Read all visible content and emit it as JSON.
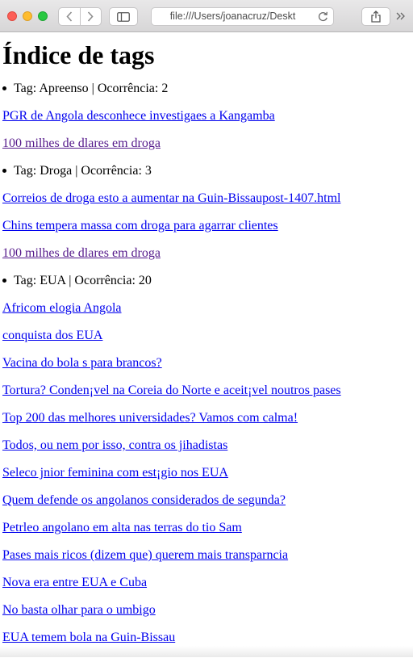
{
  "browser": {
    "url": "file:///Users/joanacruz/Deskt",
    "icons": [
      "back-icon",
      "forward-icon",
      "sidebar-icon",
      "reload-icon",
      "share-icon",
      "more-icon"
    ]
  },
  "page": {
    "title": "Índice de tags",
    "items": [
      {
        "kind": "tag",
        "text": "Tag: Apreenso | Ocorrência: 2"
      },
      {
        "kind": "link",
        "text": "PGR de Angola desconhece investigaes a Kangamba",
        "visited": false
      },
      {
        "kind": "link",
        "text": "100 milhes de dlares em droga",
        "visited": true
      },
      {
        "kind": "tag",
        "text": "Tag: Droga | Ocorrência: 3"
      },
      {
        "kind": "link",
        "text": "Correios de droga esto a aumentar na Guin-Bissaupost-1407.html",
        "visited": false
      },
      {
        "kind": "link",
        "text": "Chins tempera massa com droga para agarrar clientes",
        "visited": false
      },
      {
        "kind": "link",
        "text": "100 milhes de dlares em droga",
        "visited": true
      },
      {
        "kind": "tag",
        "text": "Tag: EUA | Ocorrência: 20"
      },
      {
        "kind": "link",
        "text": "Africom elogia Angola",
        "visited": false
      },
      {
        "kind": "link",
        "text": "conquista dos EUA",
        "visited": false
      },
      {
        "kind": "link",
        "text": "Vacina do bola s para brancos?",
        "visited": false
      },
      {
        "kind": "link",
        "text": "Tortura? Conden¡vel na Coreia do Norte e aceit¡vel noutros pases",
        "visited": false
      },
      {
        "kind": "link",
        "text": "Top 200 das melhores universidades? Vamos com calma!",
        "visited": false
      },
      {
        "kind": "link",
        "text": "Todos, ou nem por isso, contra os jihadistas",
        "visited": false
      },
      {
        "kind": "link",
        "text": "Seleco jnior feminina com est¡gio nos EUA",
        "visited": false
      },
      {
        "kind": "link",
        "text": "Quem defende os angolanos considerados de segunda?",
        "visited": false
      },
      {
        "kind": "link",
        "text": "Petrleo angolano em alta nas terras do tio Sam",
        "visited": false
      },
      {
        "kind": "link",
        "text": "Pases mais ricos (dizem que) querem mais transparncia",
        "visited": false
      },
      {
        "kind": "link",
        "text": "Nova era entre EUA e Cuba",
        "visited": false
      },
      {
        "kind": "link",
        "text": "No basta olhar para o umbigo",
        "visited": false
      },
      {
        "kind": "link",
        "text": "EUA temem bola na Guin-Bissau",
        "visited": false
      }
    ]
  }
}
